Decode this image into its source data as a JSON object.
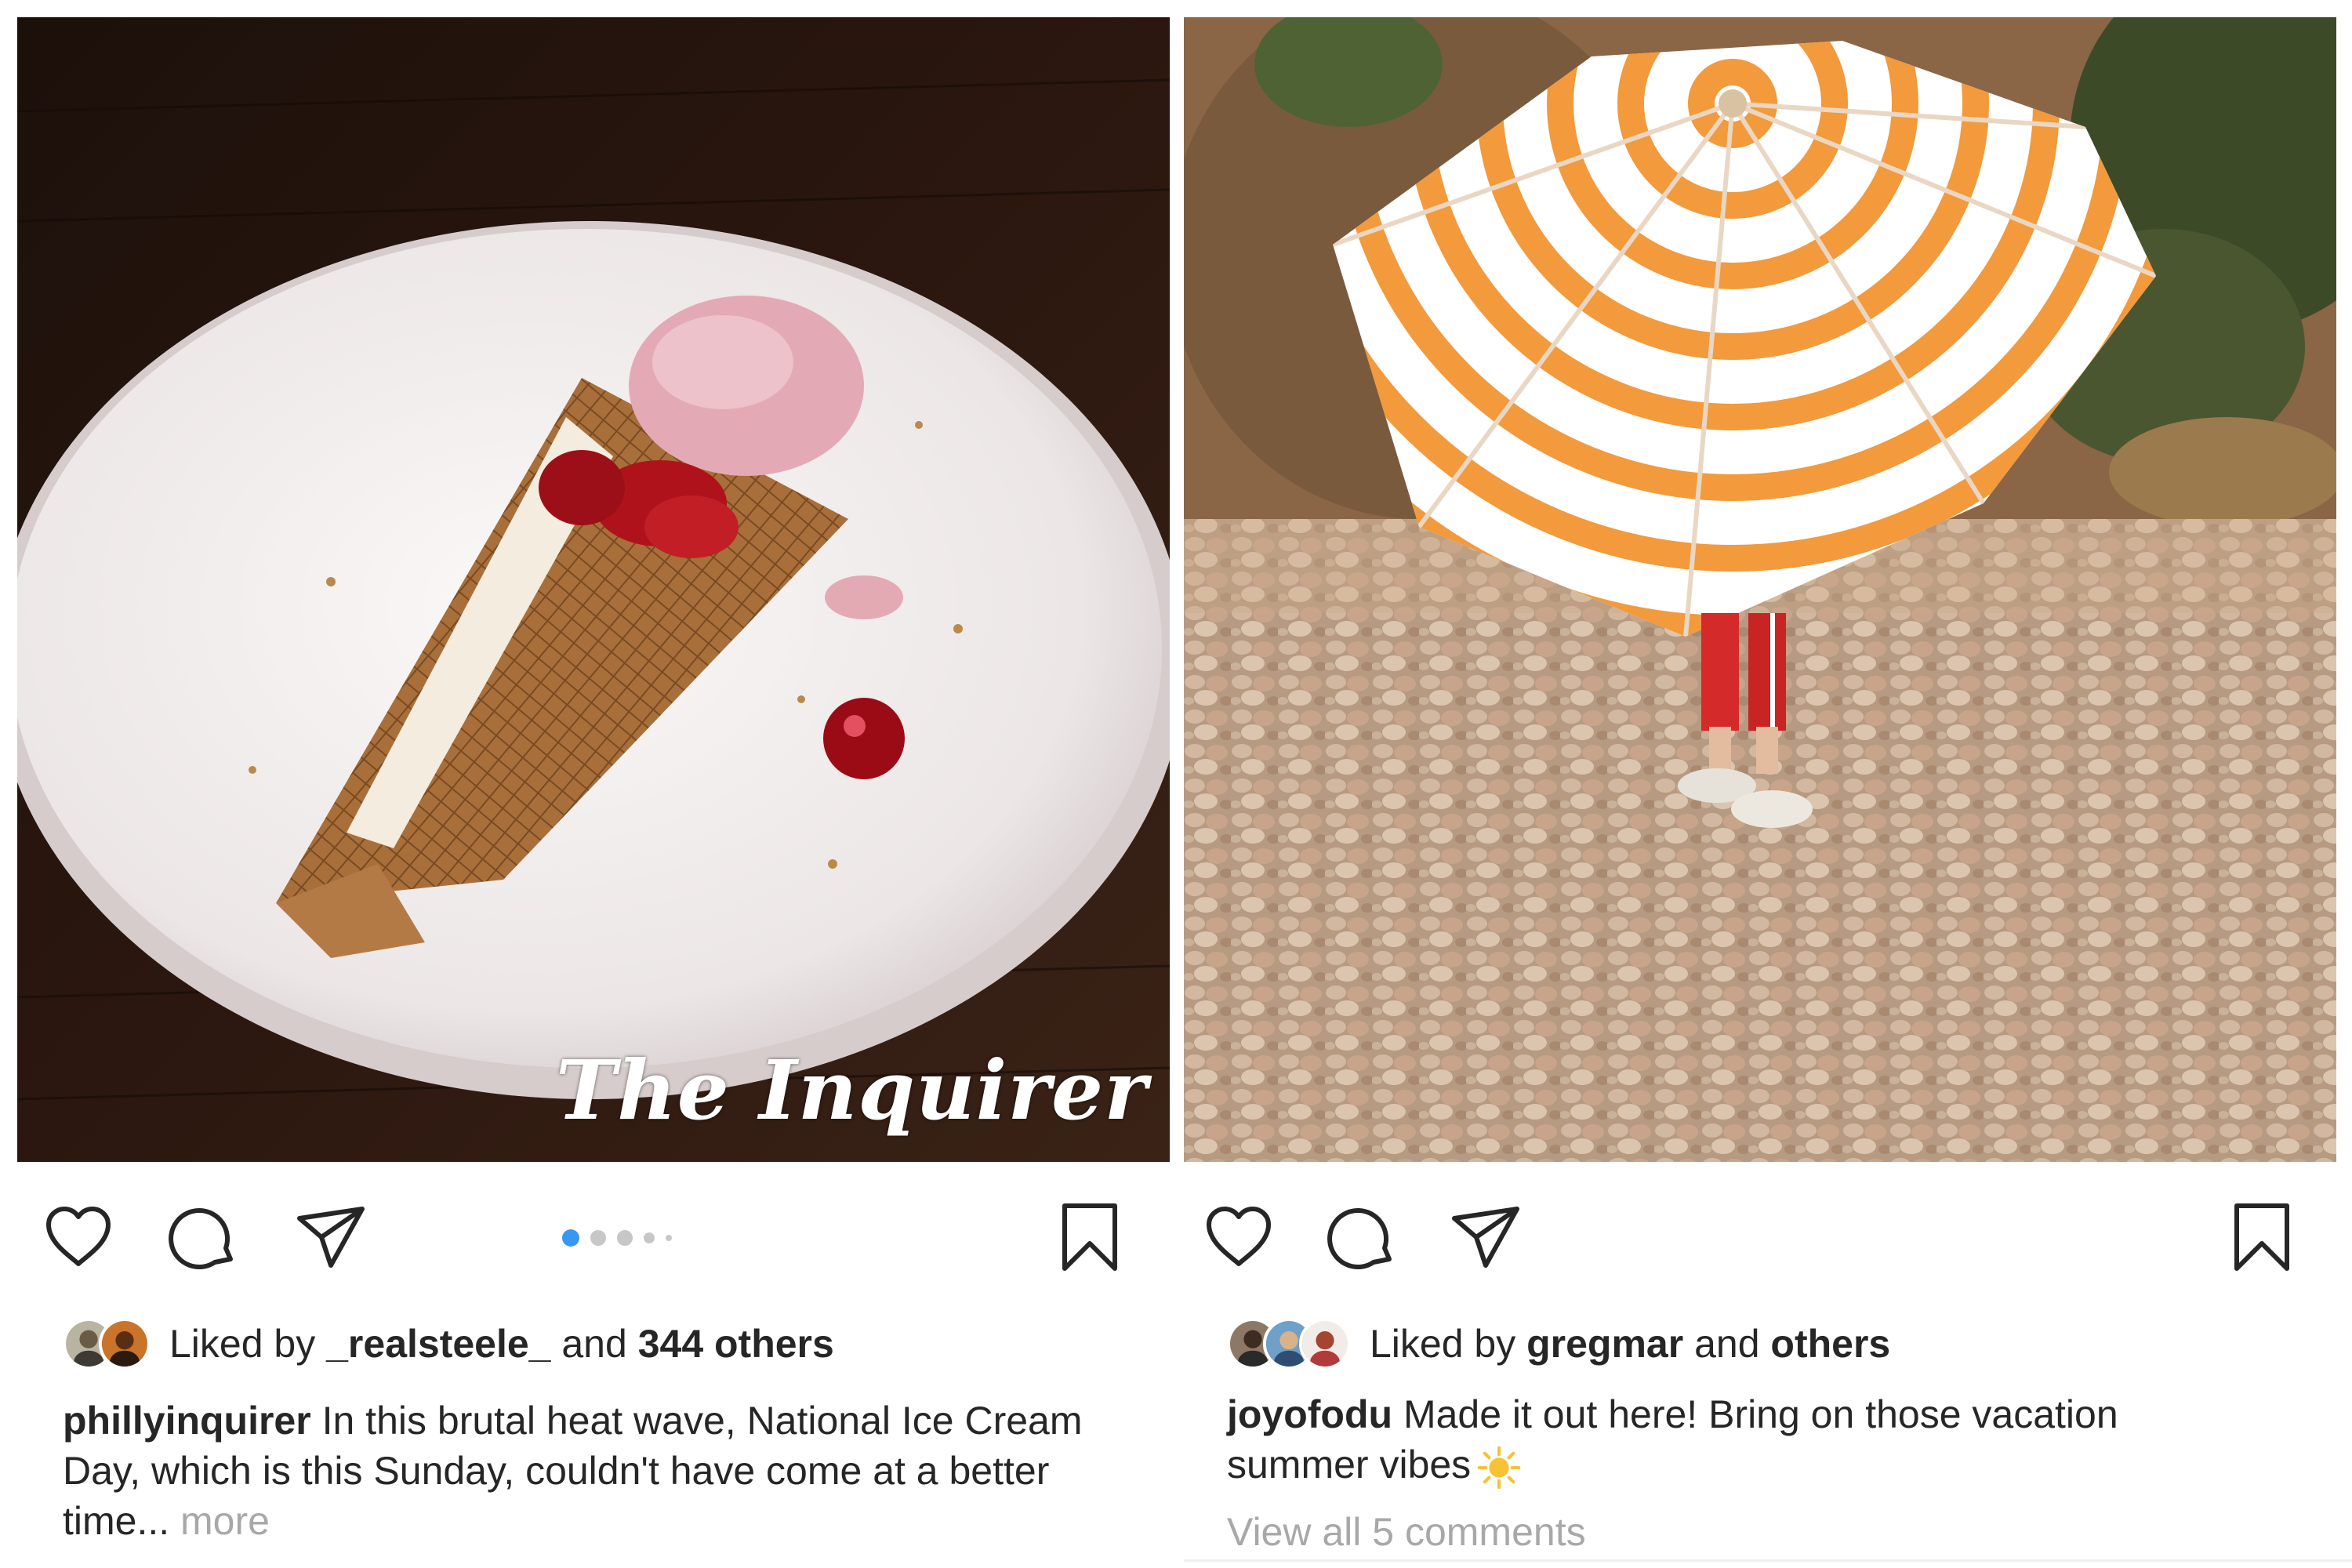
{
  "posts": [
    {
      "photo_alt": "Ice cream cone dessert on a white plate",
      "watermark": "The Inquirer",
      "actions": {
        "like_icon": "heart-icon",
        "comment_icon": "comment-icon",
        "share_icon": "paper-plane-icon",
        "save_icon": "bookmark-icon"
      },
      "carousel": {
        "total": 5,
        "active_index": 0
      },
      "likes": {
        "prefix": "Liked by ",
        "user": "_realsteele_",
        "middle": " and ",
        "count": "344 others"
      },
      "caption": {
        "author": "phillyinquirer",
        "text": " In this brutal heat wave, National Ice Cream Day, which is this Sunday, couldn't have come at a better time... ",
        "more": "more"
      }
    },
    {
      "photo_alt": "Person under an orange and white striped beach umbrella on a pebble beach",
      "actions": {
        "like_icon": "heart-icon",
        "comment_icon": "comment-icon",
        "share_icon": "paper-plane-icon",
        "save_icon": "bookmark-icon"
      },
      "likes": {
        "prefix": "Liked by ",
        "user": "gregmar",
        "middle": " and ",
        "count": "others"
      },
      "caption": {
        "author": "joyofodu",
        "text": " Made it out here! Bring on those vacation summer vibes"
      },
      "view_comments": "View all 5 comments"
    }
  ],
  "colors": {
    "active_dot": "#3897f0",
    "inactive_dot": "#c7c7c7",
    "muted_text": "#a8a8a8",
    "umbrella_orange": "#f29a3c"
  }
}
